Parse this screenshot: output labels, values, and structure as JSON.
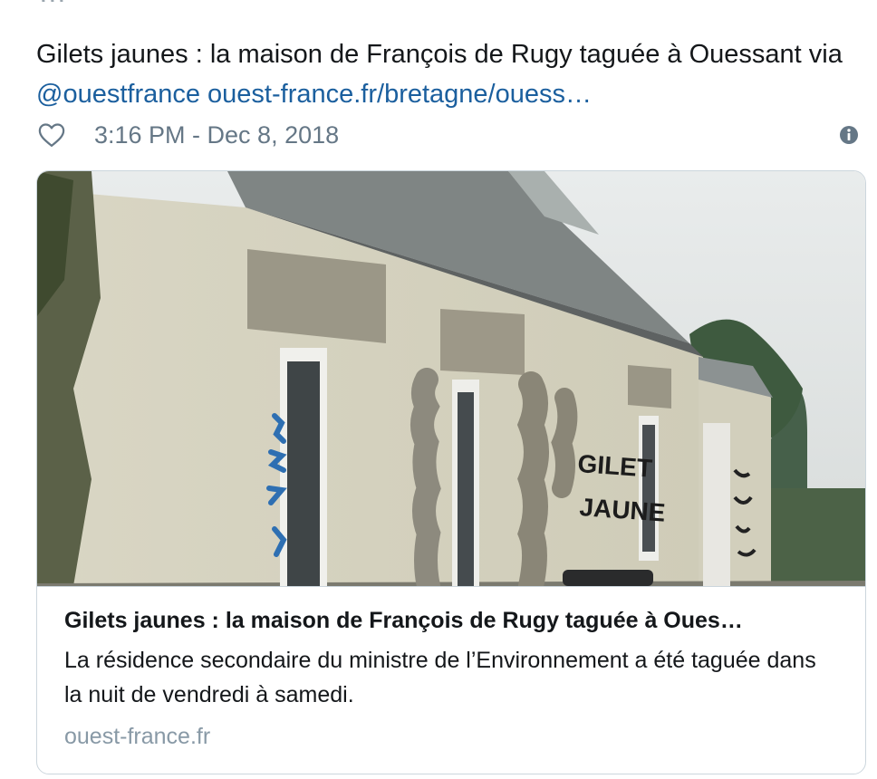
{
  "tweet": {
    "text_prefix": "Gilets jaunes : la maison de François de Rugy taguée à Ouessant via ",
    "mention": "@ouestfrance",
    "url": "ouest-france.fr/bretagne/ouess…",
    "timestamp": "3:16 PM - Dec 8, 2018"
  },
  "card": {
    "title": "Gilets jaunes : la maison de François de Rugy taguée à Oues…",
    "description": "La résidence secondaire du ministre de l’Environnement a été taguée dans la nuit de vendredi à samedi.",
    "domain": "ouest-france.fr",
    "image_graffiti": [
      "GILET",
      "JAUNE"
    ]
  },
  "icons": {
    "like": "heart-outline-icon",
    "info": "info-circle-icon"
  },
  "colors": {
    "link": "#1b5f9e",
    "muted": "#657786",
    "border": "#ccd6dd",
    "domain": "#8899a6"
  }
}
